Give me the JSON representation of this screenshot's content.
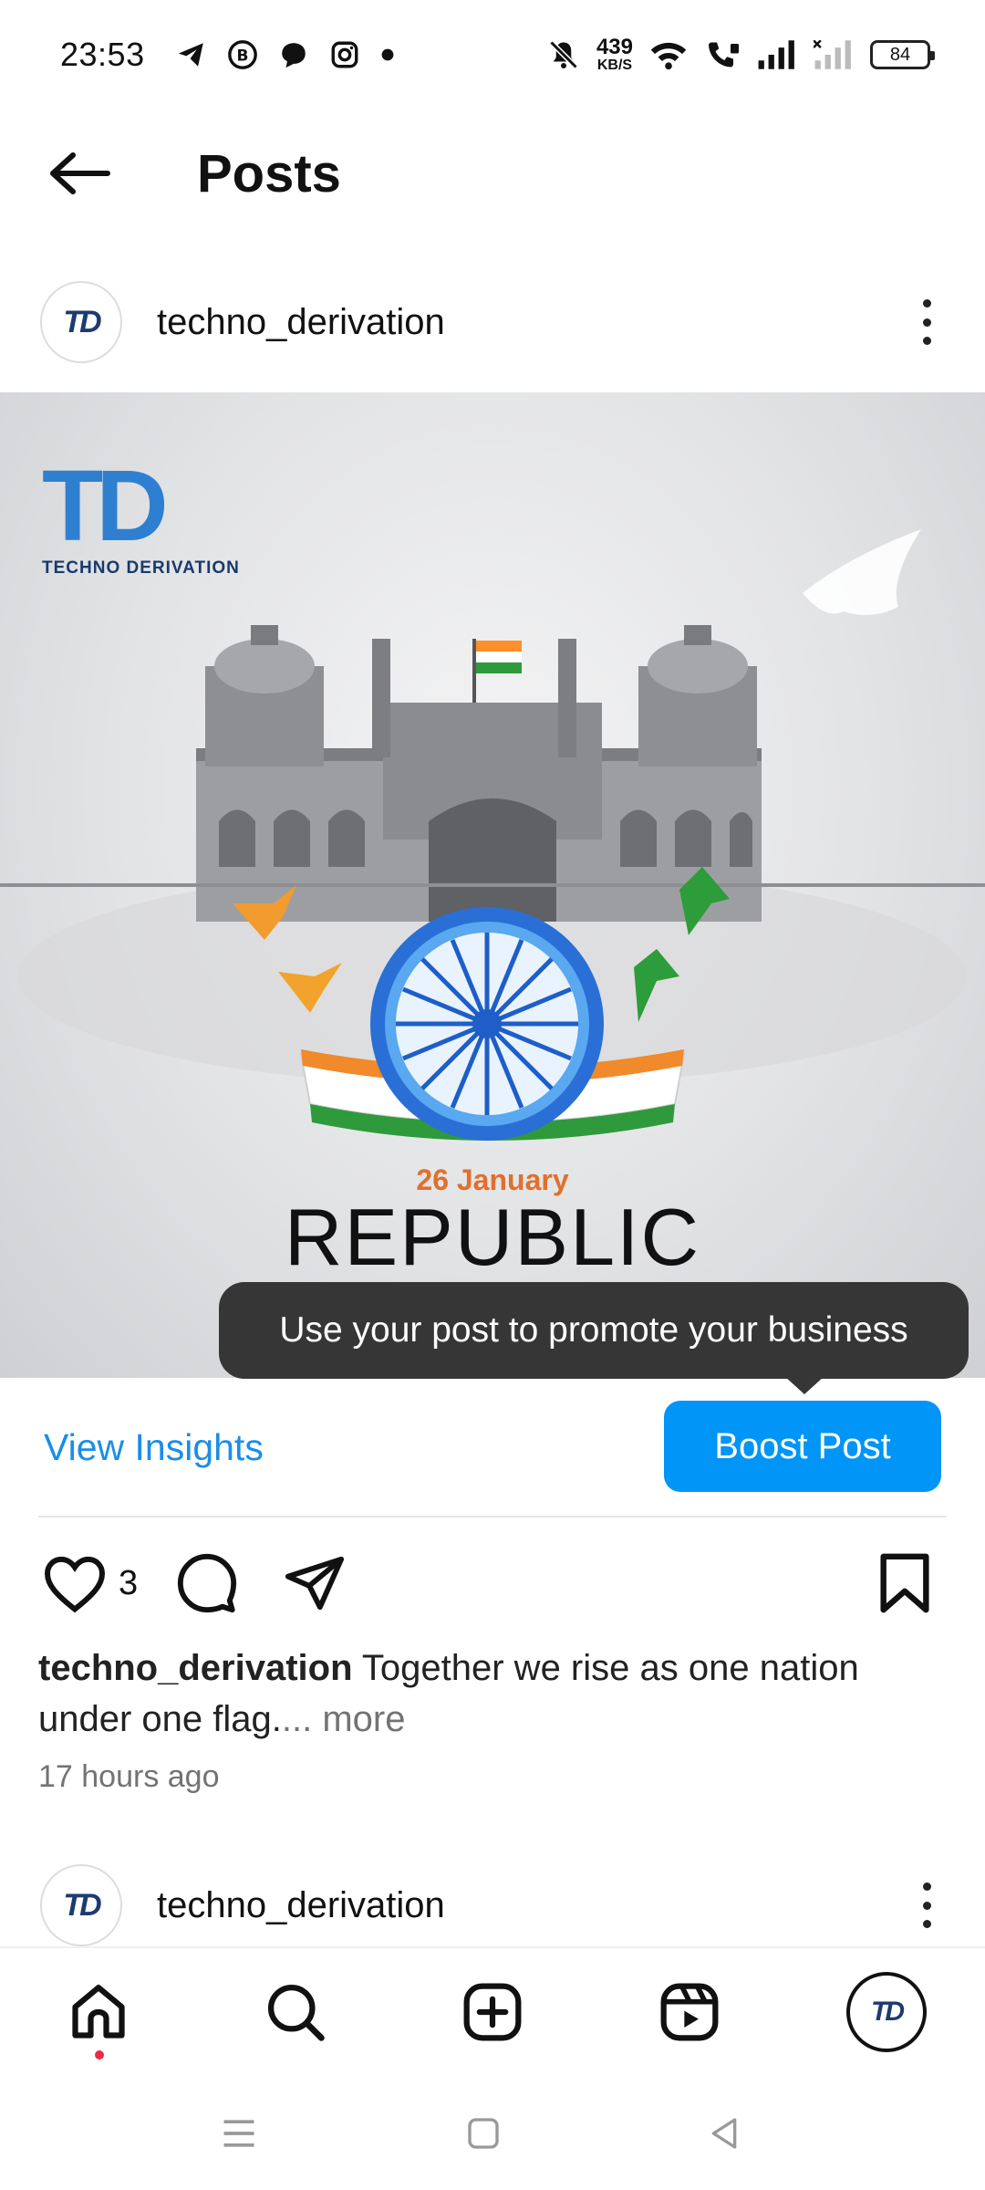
{
  "status_bar": {
    "time": "23:53",
    "net_speed_value": "439",
    "net_speed_unit": "KB/S",
    "battery": "84",
    "icons_left": [
      "telegram-icon",
      "b-icon",
      "chat-icon",
      "instagram-icon",
      "dot-icon"
    ],
    "icons_right": [
      "mute-icon",
      "wifi-icon",
      "call-icon",
      "signal-icon",
      "signal-off-icon"
    ]
  },
  "header": {
    "title": "Posts"
  },
  "post": {
    "username": "techno_derivation",
    "avatar_logo": "TD",
    "image": {
      "brand_logo": "TD",
      "brand_name": "TECHNO DERIVATION",
      "date_text": "26 January",
      "headline": "REPUBLIC"
    },
    "tooltip": "Use your post to promote your business",
    "view_insights_label": "View Insights",
    "boost_label": "Boost Post",
    "like_count": "3",
    "caption_user": "techno_derivation",
    "caption_text": " Together we rise as one nation under one flag.",
    "caption_more": "... more",
    "timestamp": "17 hours ago"
  },
  "next_post": {
    "username": "techno_derivation",
    "avatar_logo": "TD"
  },
  "bottom_nav": {
    "items": [
      "home",
      "search",
      "create",
      "reels",
      "profile"
    ],
    "active": "home"
  },
  "colors": {
    "accent": "#0095f6",
    "link": "#1a8ee8",
    "tooltip_bg": "#363636",
    "notification_dot": "#ed2a45"
  }
}
